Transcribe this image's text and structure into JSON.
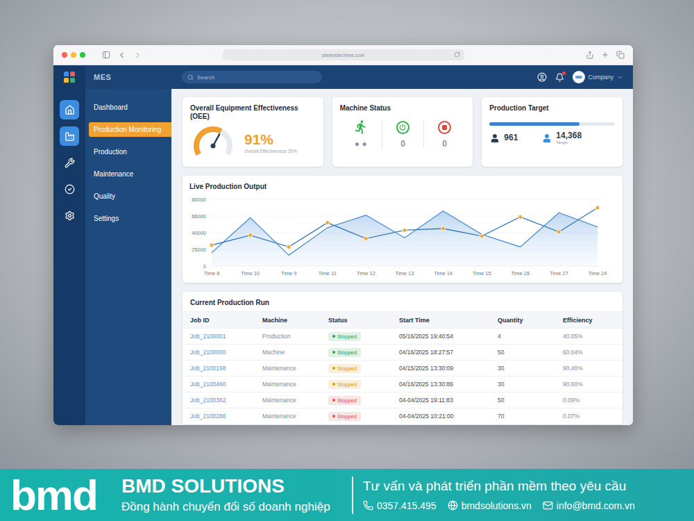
{
  "browser": {
    "url": "sitetelsite//mes.com"
  },
  "app": {
    "logo": "MES",
    "search": {
      "placeholder": "Search"
    },
    "notifications": {
      "unread": true
    },
    "account": {
      "name": "Company"
    }
  },
  "rail": [
    {
      "selected": true
    },
    {
      "selected": true
    },
    {
      "selected": false
    },
    {
      "selected": false
    },
    {
      "selected": false
    }
  ],
  "sidebar": {
    "items": [
      {
        "label": "Dashboard",
        "selected": false
      },
      {
        "label": "Production Monitoring",
        "selected": true
      },
      {
        "label": "Production",
        "selected": false
      },
      {
        "label": "Maintenance",
        "selected": false
      },
      {
        "label": "Quality",
        "selected": false
      },
      {
        "label": "Settings",
        "selected": false
      }
    ]
  },
  "oee": {
    "title": "Overall Equipment Effectiveness (OEE)",
    "value": "91%",
    "caption": "Overall Effectiveness 20%",
    "level": 0.62
  },
  "machine_status": {
    "title": "Machine Status",
    "items": [
      {
        "kind": "running",
        "value": "● ●",
        "color": "#35b24a"
      },
      {
        "kind": "idle",
        "value": "0",
        "color": "#35b24a"
      },
      {
        "kind": "stopped",
        "value": "0",
        "color": "#e0463c"
      }
    ]
  },
  "production_target": {
    "title": "Production Target",
    "level": 0.72,
    "stats": [
      {
        "value": "961",
        "caption": "",
        "color": "#2d3e50"
      },
      {
        "value": "14,368",
        "caption": "Target",
        "color": "#3a8fd9"
      }
    ]
  },
  "chart": {
    "title": "Live Production Output",
    "y_ticks": [
      "80000",
      "66000",
      "40000",
      "25000",
      "0"
    ],
    "x_labels": [
      "Time 6",
      "Time 10",
      "Time 9",
      "Time 11",
      "Time 12",
      "Time 13",
      "Time 14",
      "Time 15",
      "Time 28",
      "Time 27",
      "Time 24"
    ],
    "series": [
      {
        "kind": "area",
        "values": [
          16000,
          58000,
          13000,
          46000,
          61000,
          34000,
          66000,
          38000,
          23000,
          64000,
          47000
        ]
      },
      {
        "kind": "dotted",
        "values": [
          25000,
          37000,
          23000,
          52000,
          33000,
          43000,
          45000,
          36000,
          59000,
          41000,
          70000
        ]
      }
    ]
  },
  "table": {
    "title": "Current Production Run",
    "columns": [
      "Job ID",
      "Machine",
      "Status",
      "Start Time",
      "Quantity",
      "Efficiency"
    ],
    "rows": [
      {
        "job_id": "Job_2100001",
        "machine": "Production",
        "status": "Stopped",
        "color": "#2e9e4f",
        "start": "05/16/2025 19:40:54",
        "quantity": "4",
        "efficiency": "40.05%"
      },
      {
        "job_id": "Job_2100000",
        "machine": "Machine",
        "status": "Stopped",
        "color": "#2e9e4f",
        "start": "04/16/2025 18:27:57",
        "quantity": "50",
        "efficiency": "60.04%"
      },
      {
        "job_id": "Job_2100198",
        "machine": "Maintenance",
        "status": "Stopped",
        "color": "#d99a12",
        "start": "04/15/2025 13:30:09",
        "quantity": "30",
        "efficiency": "90.40%"
      },
      {
        "job_id": "Job_2100460",
        "machine": "Maintenance",
        "status": "Stopped",
        "color": "#d99a12",
        "start": "04/16/2025 13:30:86",
        "quantity": "30",
        "efficiency": "90.60%"
      },
      {
        "job_id": "Job_2100362",
        "machine": "Maintenance",
        "status": "Stopped",
        "color": "#e05050",
        "start": "04-04/2025 19:11:83",
        "quantity": "50",
        "efficiency": "0.09%"
      },
      {
        "job_id": "Job_2100286",
        "machine": "Maintenance",
        "status": "Stopped",
        "color": "#e05050",
        "start": "04-04/2025 10:21:00",
        "quantity": "70",
        "efficiency": "0.07%"
      }
    ]
  },
  "banner": {
    "logo": "bmd",
    "name": "BMD SOLUTIONS",
    "tagline": "Đồng hành chuyển đổi số doanh nghiệp",
    "headline": "Tư vấn và phát triển phần mềm theo yêu cầu",
    "contacts": [
      {
        "kind": "phone",
        "text": "0357.415.495"
      },
      {
        "kind": "web",
        "text": "bmdsolutions.vn"
      },
      {
        "kind": "mail",
        "text": "info@bmd.com.vn"
      }
    ]
  }
}
